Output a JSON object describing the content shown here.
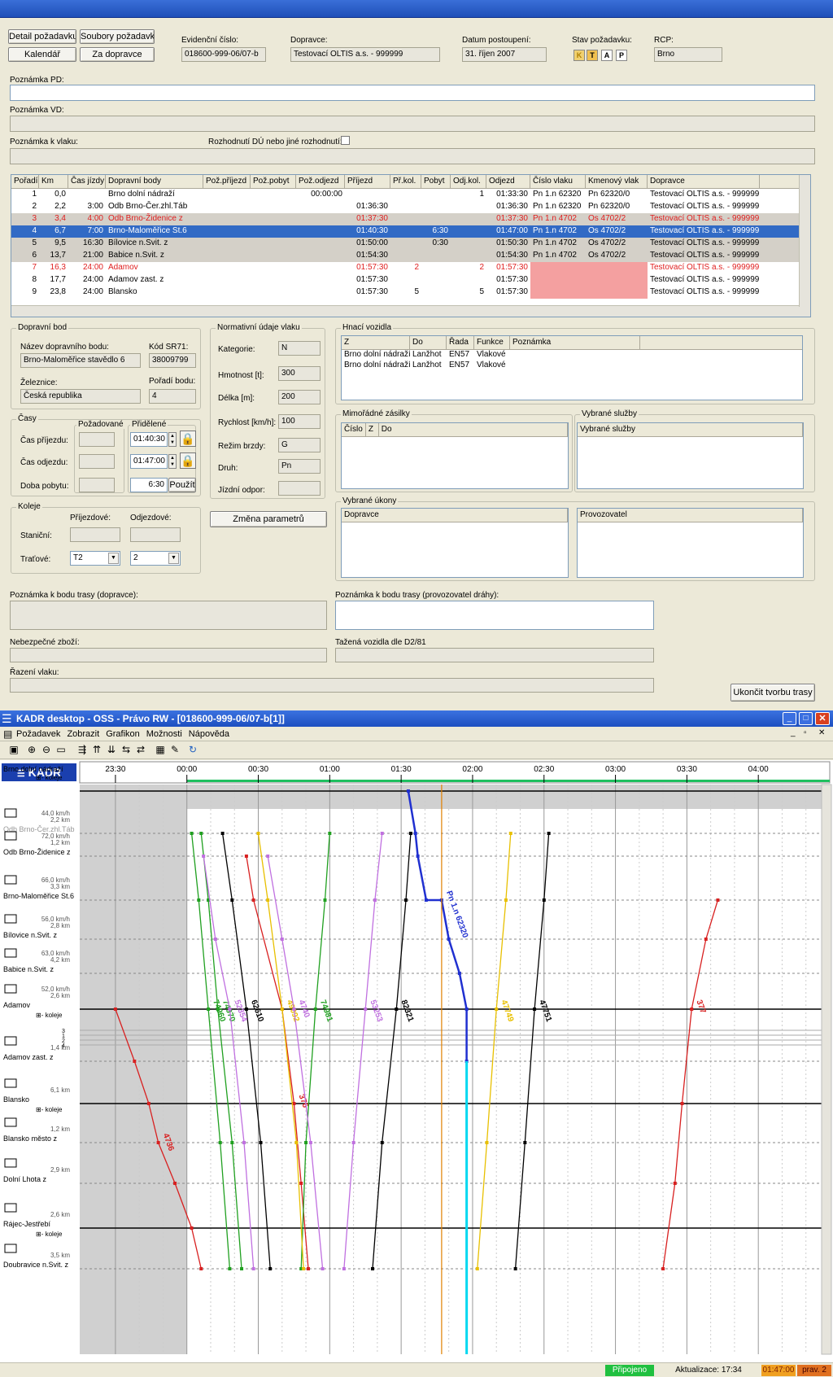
{
  "form": {
    "buttons": {
      "detail": "Detail požadavku",
      "soubory": "Soubory požadavku",
      "kalendar": "Kalendář",
      "za_dopravce": "Za dopravce",
      "ukoncit": "Ukončit tvorbu trasy",
      "zmena": "Změna parametrů",
      "pouzit": "Použít"
    },
    "header": {
      "evid_label": "Evidenční číslo:",
      "evid_value": "018600-999-06/07-b",
      "dopravce_label": "Dopravce:",
      "dopravce_value": "Testovací OLTIS a.s. - 999999",
      "datum_label": "Datum postoupení:",
      "datum_value": "31. říjen 2007",
      "stav_label": "Stav požadavku:",
      "stav_letters": [
        "K",
        "T",
        "A",
        "P"
      ],
      "rcp_label": "RCP:",
      "rcp_value": "Brno"
    },
    "notes": {
      "pd": "Poznámka PD:",
      "vd": "Poznámka VD:",
      "vlak": "Poznámka k vlaku:",
      "rozhodnuti": "Rozhodnutí DÚ nebo jiné rozhodnutí:"
    },
    "table": {
      "headers": [
        "Pořadí",
        "Km",
        "Čas jízdy",
        "Dopravní body",
        "Pož.příjezd",
        "Pož.pobyt",
        "Pož.odjezd",
        "Příjezd",
        "Př.kol.",
        "Pobyt",
        "Odj.kol.",
        "Odjezd",
        "Číslo vlaku",
        "Kmenový vlak",
        "Dopravce"
      ],
      "rows": [
        {
          "c": [
            "1",
            "0,0",
            "",
            "Brno dolní nádraží",
            "",
            "",
            "00:00:00",
            "",
            "",
            "",
            "1",
            "01:33:30",
            "Pn 1.n 62320",
            "Pn 62320/0",
            "Testovací OLTIS a.s. - 999999"
          ],
          "style": "normal"
        },
        {
          "c": [
            "2",
            "2,2",
            "3:00",
            "Odb Brno-Čer.zhl.Táb",
            "",
            "",
            "",
            "01:36:30",
            "",
            "",
            "",
            "01:36:30",
            "Pn 1.n 62320",
            "Pn 62320/0",
            "Testovací OLTIS a.s. - 999999"
          ],
          "style": "normal"
        },
        {
          "c": [
            "3",
            "3,4",
            "4:00",
            "Odb Brno-Židenice z",
            "",
            "",
            "",
            "01:37:30",
            "",
            "",
            "",
            "01:37:30",
            "Pn 1.n 4702",
            "Os 4702/2",
            "Testovací OLTIS a.s. - 999999"
          ],
          "style": "grayred"
        },
        {
          "c": [
            "4",
            "6,7",
            "7:00",
            "Brno-Maloměřice St.6",
            "",
            "",
            "",
            "01:40:30",
            "",
            "6:30",
            "",
            "01:47:00",
            "Pn 1.n 4702",
            "Os 4702/2",
            "Testovací OLTIS a.s. - 999999"
          ],
          "style": "selected"
        },
        {
          "c": [
            "5",
            "9,5",
            "16:30",
            "Bílovice n.Svit. z",
            "",
            "",
            "",
            "01:50:00",
            "",
            "0:30",
            "",
            "01:50:30",
            "Pn 1.n 4702",
            "Os 4702/2",
            "Testovací OLTIS a.s. - 999999"
          ],
          "style": "gray"
        },
        {
          "c": [
            "6",
            "13,7",
            "21:00",
            "Babice n.Svit. z",
            "",
            "",
            "",
            "01:54:30",
            "",
            "",
            "",
            "01:54:30",
            "Pn 1.n 4702",
            "Os 4702/2",
            "Testovací OLTIS a.s. - 999999"
          ],
          "style": "gray"
        },
        {
          "c": [
            "7",
            "16,3",
            "24:00",
            "Adamov",
            "",
            "",
            "",
            "01:57:30",
            "2",
            "",
            "2",
            "01:57:30",
            "",
            "",
            "Testovací OLTIS a.s. - 999999"
          ],
          "style": "red"
        },
        {
          "c": [
            "8",
            "17,7",
            "24:00",
            "Adamov zast. z",
            "",
            "",
            "",
            "01:57:30",
            "",
            "",
            "",
            "01:57:30",
            "",
            "",
            "Testovací OLTIS a.s. - 999999"
          ],
          "style": "pink"
        },
        {
          "c": [
            "9",
            "23,8",
            "24:00",
            "Blansko",
            "",
            "",
            "",
            "01:57:30",
            "5",
            "",
            "5",
            "01:57:30",
            "",
            "",
            "Testovací OLTIS a.s. - 999999"
          ],
          "style": "pink"
        }
      ]
    },
    "dopravni_bod": {
      "title": "Dopravní bod",
      "nazev_label": "Název dopravního bodu:",
      "nazev": "Brno-Maloměřice stavědlo 6",
      "kod_label": "Kód SR71:",
      "kod": "38009799",
      "zel_label": "Železnice:",
      "zel": "Česká republika",
      "poradi_label": "Pořadí bodu:",
      "poradi": "4"
    },
    "casy": {
      "title": "Časy",
      "pozadovane": "Požadované",
      "pridelene": "Přidělené",
      "prijezd_label": "Čas příjezdu:",
      "prijezd": "01:40:30",
      "odjezd_label": "Čas odjezdu:",
      "odjezd": "01:47:00",
      "pobyt_label": "Doba pobytu:",
      "pobyt": "6:30"
    },
    "koleje": {
      "title": "Koleje",
      "prijezdove": "Příjezdové:",
      "odjezdove": "Odjezdové:",
      "stanicni": "Staniční:",
      "tratove": "Traťové:",
      "tr_prij": "T2",
      "tr_odj": "2"
    },
    "normativni": {
      "title": "Normativní údaje vlaku",
      "kategorie_label": "Kategorie:",
      "kategorie": "N",
      "hmotnost_label": "Hmotnost [t]:",
      "hmotnost": "300",
      "delka_label": "Délka [m]:",
      "delka": "200",
      "rychlost_label": "Rychlost [km/h]:",
      "rychlost": "100",
      "rezim_label": "Režim brzdy:",
      "rezim": "G",
      "druh_label": "Druh:",
      "druh": "Pn",
      "odpor_label": "Jízdní odpor:"
    },
    "hnaci": {
      "title": "Hnací vozidla",
      "headers": [
        "Z",
        "Do",
        "Řada",
        "Funkce",
        "Poznámka"
      ],
      "rows": [
        [
          "Brno dolní nádraží",
          "Lanžhot",
          "EN57",
          "Vlakové",
          ""
        ],
        [
          "Brno dolní nádraží",
          "Lanžhot",
          "EN57",
          "Vlakové",
          ""
        ]
      ]
    },
    "mimoradne": {
      "title": "Mimořádné zásilky",
      "headers": [
        "Číslo",
        "Z",
        "Do"
      ]
    },
    "vybrane_sluzby": {
      "title": "Vybrané služby",
      "header": "Vybrané služby"
    },
    "vybrane_ukony": {
      "title": "Vybrané úkony",
      "dopravce": "Dopravce",
      "provozovatel": "Provozovatel"
    },
    "bottom": {
      "pozn_dopravce": "Poznámka k bodu trasy (dopravce):",
      "pozn_provoz": "Poznámka k bodu trasy (provozovatel dráhy):",
      "nebezpecne": "Nebezpečné zboží:",
      "tazena": "Tažená vozidla dle D2/81",
      "razeni": "Řazení vlaku:"
    }
  },
  "app": {
    "title": "KADR desktop - OSS - Právo RW - [018600-999-06/07-b[1]]",
    "menu": [
      "Požadavek",
      "Zobrazit",
      "Grafikon",
      "Možnosti",
      "Nápověda"
    ],
    "logo": "KADR",
    "status": {
      "pripojeno": "Připojeno",
      "aktualizace": "Aktualizace: 17:34",
      "time": "01:47:00",
      "prav": "prav. 2"
    }
  },
  "chart_data": {
    "type": "line",
    "title": "",
    "x_ticks": [
      "23:30",
      "00:00",
      "00:30",
      "01:00",
      "01:30",
      "02:00",
      "02:30",
      "03:00",
      "03:30",
      "04:00"
    ],
    "stations": [
      {
        "name": "Brno dolní nádraží",
        "speed": "",
        "dist": "",
        "koleje": true
      },
      {
        "name": "Odb Brno-Čer.zhl.Táb",
        "speed": "44,0 km/h",
        "dist": "2,2 km",
        "koleje": false
      },
      {
        "name": "Odb Brno-Židenice z",
        "speed": "72,0 km/h",
        "dist": "1,2 km",
        "koleje": false
      },
      {
        "name": "Brno-Maloměřice St.6",
        "speed": "66,0 km/h",
        "dist": "3,3 km",
        "koleje": false
      },
      {
        "name": "Bílovice n.Svit. z",
        "speed": "56,0 km/h",
        "dist": "2,8 km",
        "koleje": false
      },
      {
        "name": "Babice n.Svit. z",
        "speed": "63,0 km/h",
        "dist": "4,2 km",
        "koleje": false
      },
      {
        "name": "Adamov",
        "speed": "52,0 km/h",
        "dist": "2,6 km",
        "koleje": true
      },
      {
        "name": "Adamov zast. z",
        "speed": "",
        "dist": "1,4 km",
        "koleje": false
      },
      {
        "name": "Blansko",
        "speed": "",
        "dist": "6,1 km",
        "koleje": true
      },
      {
        "name": "Blansko město z",
        "speed": "",
        "dist": "1,2 km",
        "koleje": false
      },
      {
        "name": "Dolní Lhota z",
        "speed": "",
        "dist": "2,9 km",
        "koleje": false
      },
      {
        "name": "Rájec-Jestřebí",
        "speed": "",
        "dist": "2,6 km",
        "koleje": true
      },
      {
        "name": "Doubravice n.Svit. z",
        "speed": "",
        "dist": "3,5 km",
        "koleje": false
      }
    ],
    "adamov_tracks": [
      "3",
      "1",
      "2",
      "4"
    ],
    "koleje_label": "koleje",
    "series": [
      {
        "name": "Pn 1.n 62320",
        "color": "#2030d0",
        "points": [
          [
            93,
            0
          ],
          [
            96,
            1
          ],
          [
            97,
            2
          ],
          [
            100.5,
            3
          ],
          [
            107,
            3
          ],
          [
            110,
            4
          ],
          [
            114.5,
            5
          ],
          [
            117.5,
            6
          ],
          [
            117.5,
            7
          ]
        ]
      },
      {
        "name": "4736",
        "color": "#d82020",
        "points": [
          [
            -30,
            6
          ],
          [
            -22,
            7
          ],
          [
            -16,
            8
          ],
          [
            -12,
            9
          ],
          [
            -5,
            10
          ],
          [
            2,
            11
          ],
          [
            6,
            12
          ]
        ]
      },
      {
        "name": "376",
        "color": "#d82020",
        "points": [
          [
            25,
            2
          ],
          [
            28,
            3
          ],
          [
            40,
            6
          ],
          [
            45,
            8
          ],
          [
            48,
            10
          ],
          [
            51,
            12
          ]
        ]
      },
      {
        "name": "377",
        "color": "#d82020",
        "points": [
          [
            200,
            12
          ],
          [
            205,
            10
          ],
          [
            208,
            8
          ],
          [
            212,
            6
          ],
          [
            218,
            4
          ],
          [
            223,
            3
          ]
        ]
      },
      {
        "name": "74960",
        "color": "#20a020",
        "points": [
          [
            2,
            1
          ],
          [
            5,
            3
          ],
          [
            9,
            6
          ],
          [
            14,
            9
          ],
          [
            18,
            12
          ]
        ]
      },
      {
        "name": "74970",
        "color": "#20a020",
        "points": [
          [
            6,
            1
          ],
          [
            9,
            3
          ],
          [
            13,
            6
          ],
          [
            19,
            9
          ],
          [
            23,
            12
          ]
        ]
      },
      {
        "name": "74981",
        "color": "#20a020",
        "points": [
          [
            48,
            12
          ],
          [
            50,
            9
          ],
          [
            54,
            6
          ],
          [
            58,
            3
          ],
          [
            60,
            1
          ]
        ]
      },
      {
        "name": "62610",
        "color": "#000000",
        "points": [
          [
            15,
            1
          ],
          [
            19,
            3
          ],
          [
            25,
            6
          ],
          [
            31,
            9
          ],
          [
            35,
            12
          ]
        ]
      },
      {
        "name": "82321",
        "color": "#000000",
        "points": [
          [
            78,
            12
          ],
          [
            82,
            9
          ],
          [
            88,
            6
          ],
          [
            92,
            3
          ],
          [
            94,
            1
          ]
        ]
      },
      {
        "name": "47751",
        "color": "#000000",
        "points": [
          [
            138,
            12
          ],
          [
            142,
            9
          ],
          [
            146,
            6
          ],
          [
            150,
            3
          ],
          [
            152,
            1
          ]
        ]
      },
      {
        "name": "49092",
        "color": "#e8c000",
        "points": [
          [
            30,
            1
          ],
          [
            34,
            3
          ],
          [
            40,
            6
          ],
          [
            46,
            9
          ],
          [
            49,
            12
          ]
        ]
      },
      {
        "name": "47749",
        "color": "#e8c000",
        "points": [
          [
            122,
            12
          ],
          [
            126,
            9
          ],
          [
            130,
            6
          ],
          [
            134,
            3
          ],
          [
            136,
            1
          ]
        ]
      },
      {
        "name": "52354",
        "color": "#c070e0",
        "points": [
          [
            7,
            2
          ],
          [
            12,
            4
          ],
          [
            18,
            6
          ],
          [
            24,
            9
          ],
          [
            28,
            12
          ]
        ]
      },
      {
        "name": "53253",
        "color": "#c070e0",
        "points": [
          [
            66,
            12
          ],
          [
            70,
            9
          ],
          [
            75,
            6
          ],
          [
            79,
            3
          ],
          [
            82,
            1
          ]
        ]
      },
      {
        "name": "4740",
        "color": "#c070e0",
        "points": [
          [
            34,
            2
          ],
          [
            40,
            4
          ],
          [
            45,
            6
          ],
          [
            52,
            9
          ],
          [
            57,
            12
          ]
        ]
      }
    ]
  }
}
